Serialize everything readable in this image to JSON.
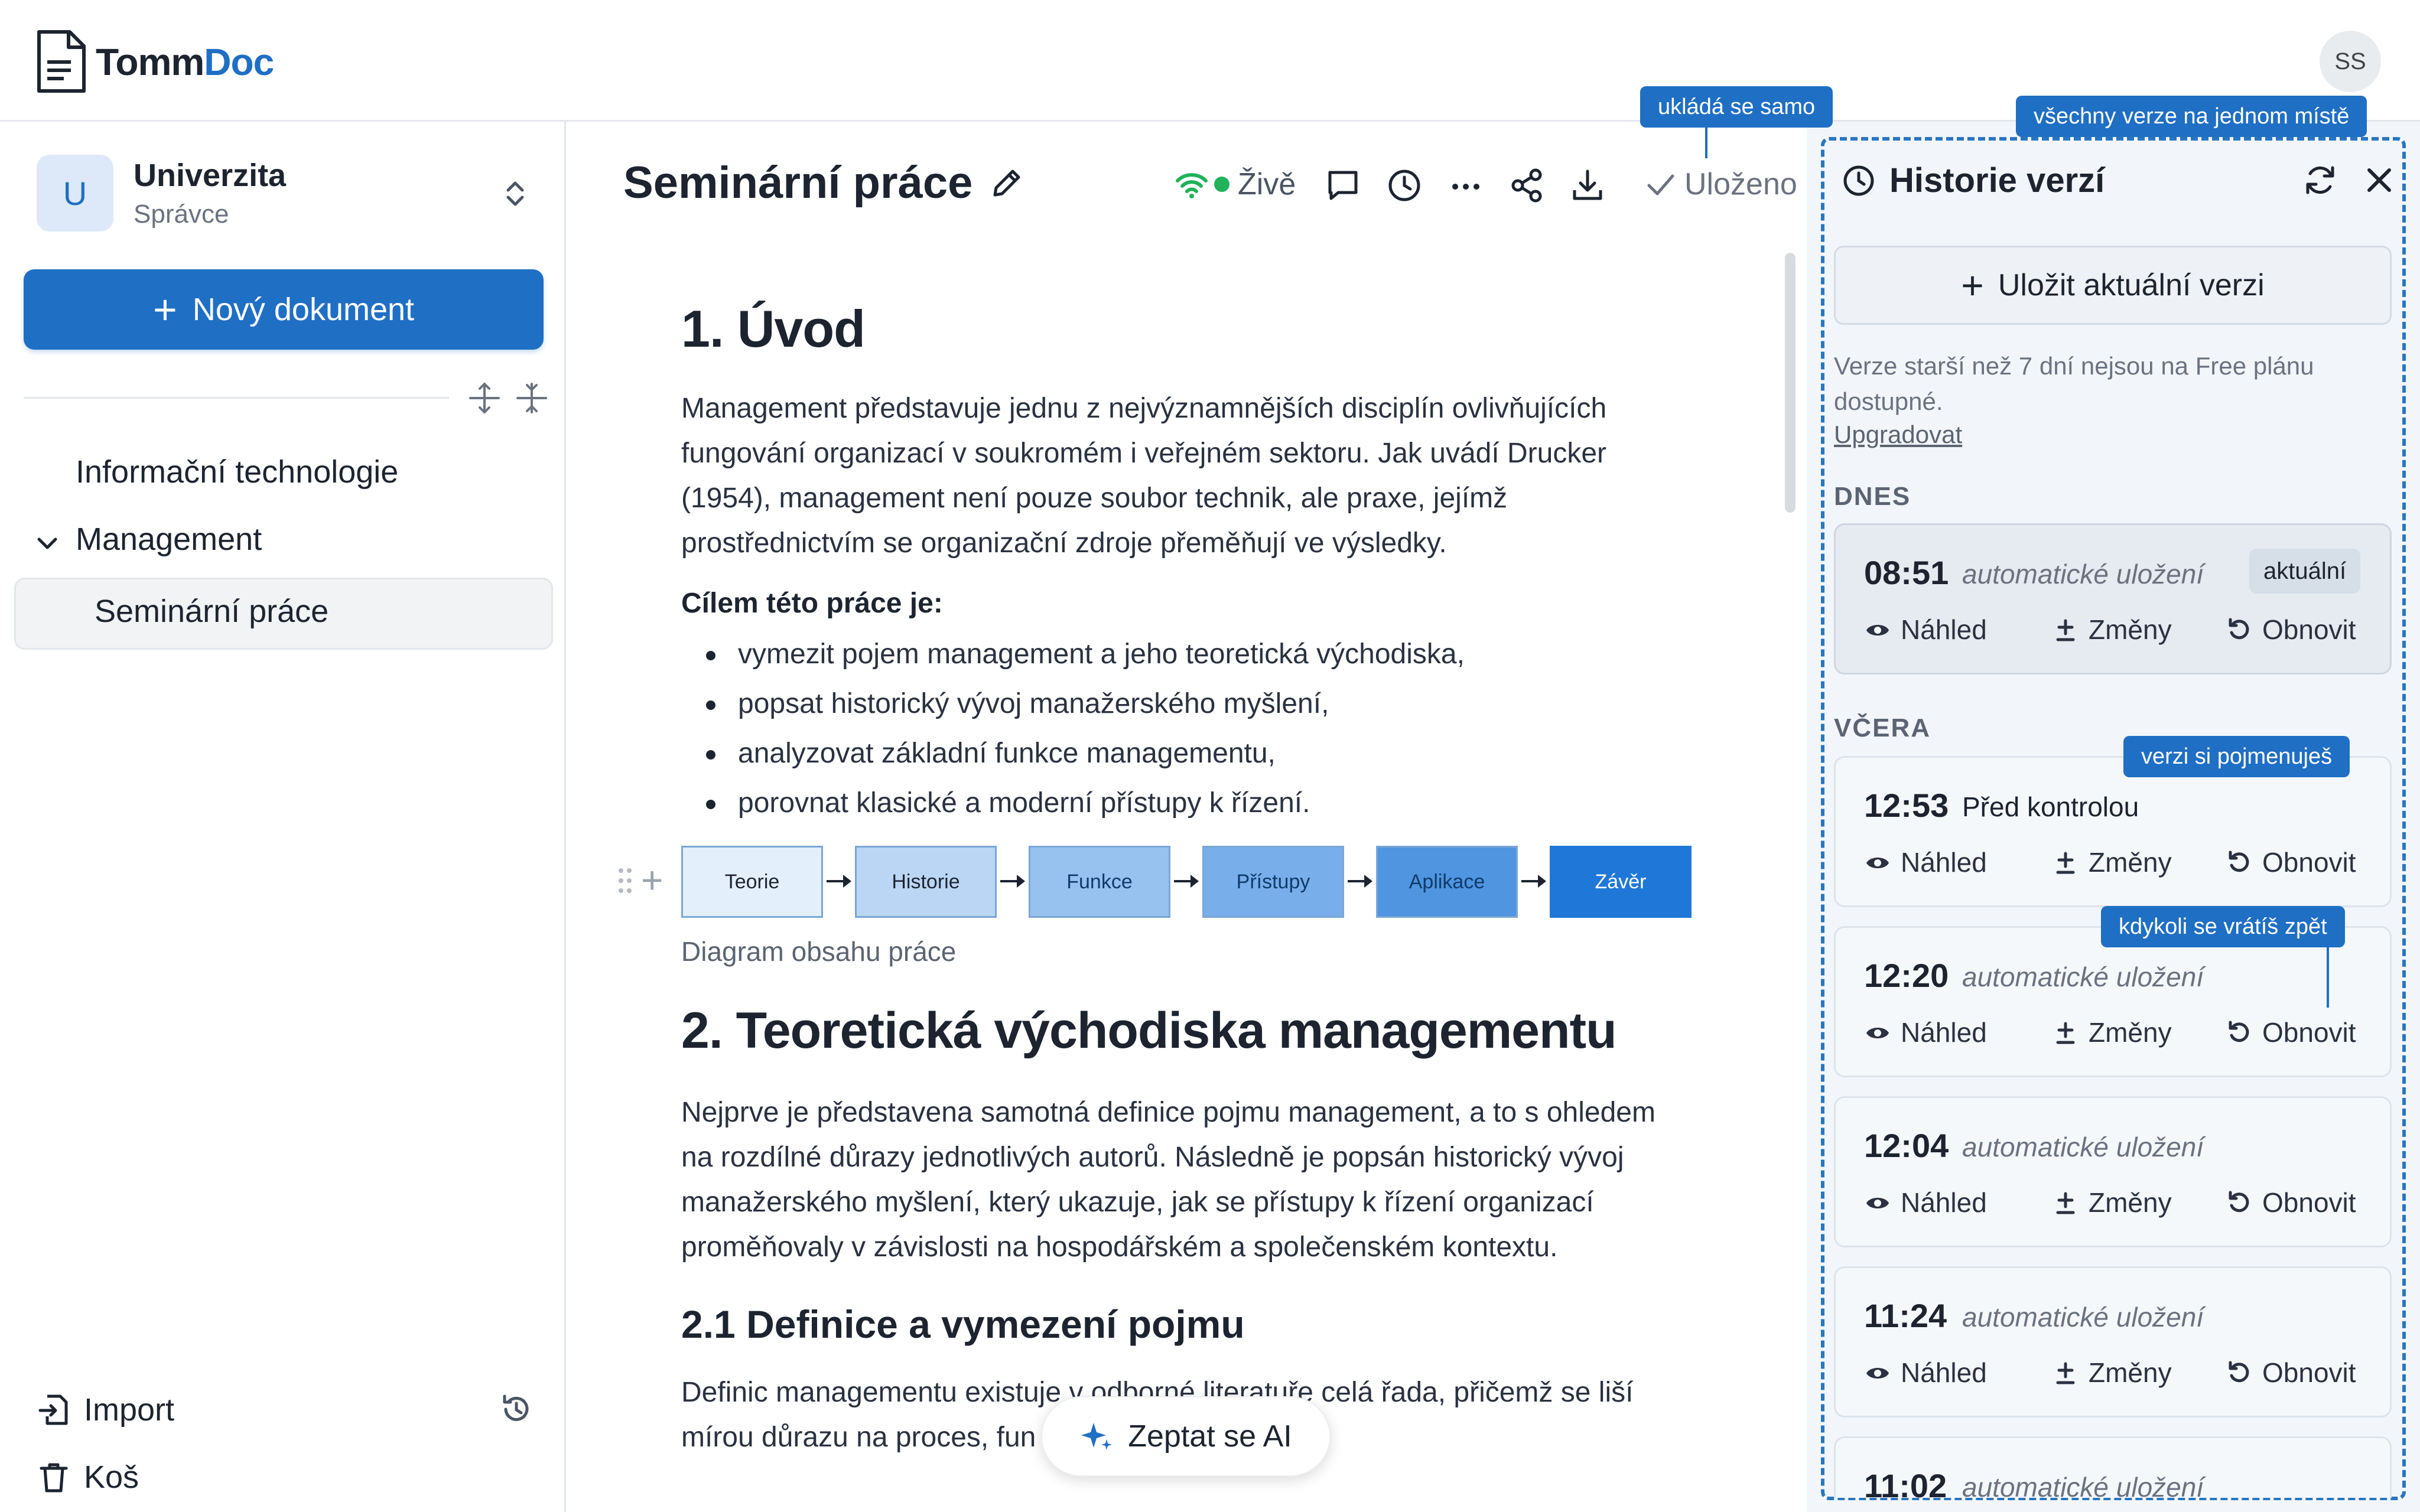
{
  "app": {
    "logo_part1": "Tomm",
    "logo_part2": "Doc",
    "user_initials": "SS"
  },
  "sidebar": {
    "workspace_initial": "U",
    "workspace_name": "Univerzita",
    "workspace_role": "Správce",
    "new_doc_label": "Nový dokument",
    "tree": [
      {
        "label": "Informační technologie"
      },
      {
        "label": "Management"
      },
      {
        "label": "Seminární práce"
      }
    ],
    "import_label": "Import",
    "trash_label": "Koš"
  },
  "editor": {
    "title": "Seminární práce",
    "live_label": "Živě",
    "saved_label": "Uloženo",
    "h1_intro": "1. Úvod",
    "p1_lines": [
      "Management představuje jednu z nejvýznamnějších disciplín ovlivňujících",
      "fungování organizací v soukromém i veřejném sektoru. Jak uvádí Drucker",
      "(1954), management není pouze soubor technik, ale praxe, jejímž",
      "prostřednictvím se organizační zdroje přeměňují ve výsledky."
    ],
    "goals_label": "Cílem této práce je:",
    "bullets": [
      "vymezit pojem management a jeho teoretická východiska,",
      "popsat historický vývoj manažerského myšlení,",
      "analyzovat základní funkce managementu,",
      "porovnat klasické a moderní přístupy k řízení."
    ],
    "diagram_nodes": [
      "Teorie",
      "Historie",
      "Funkce",
      "Přístupy",
      "Aplikace",
      "Závěr"
    ],
    "diagram_colors": [
      "#e3effb",
      "#bad6f4",
      "#97c2ef",
      "#78afea",
      "#4f95e0",
      "#1f78d8"
    ],
    "diagram_caption": "Diagram obsahu práce",
    "h1_theory": "2. Teoretická východiska managementu",
    "p2_lines": [
      "Nejprve je představena samotná definice pojmu management, a to s ohledem",
      "na rozdílné důrazy jednotlivých autorů. Následně je popsán historický vývoj",
      "manažerského myšlení, který ukazuje, jak se přístupy k řízení organizací",
      "proměňovaly v závislosti na hospodářském a společenském kontextu."
    ],
    "h2_definition": "2.1 Definice a vymezení pojmu",
    "p3_lines": [
      "Definic managementu existuje v odborné literatuře celá řada, přičemž se liší",
      "mírou důrazu na proces, fun"
    ],
    "ai_button_label": "Zeptat se AI"
  },
  "history": {
    "title": "Historie verzí",
    "save_current_label": "Uložit aktuální verzi",
    "note": "Verze starší než 7 dní nejsou na Free plánu dostupné.",
    "upgrade_label": "Upgradovat",
    "section_today": "DNES",
    "section_yesterday": "VČERA",
    "action_preview": "Náhled",
    "action_changes": "Změny",
    "action_restore": "Obnovit",
    "versions": [
      {
        "time": "08:51",
        "label": "automatické uložení",
        "badge": "aktuální"
      },
      {
        "time": "12:53",
        "label": "Před kontrolou"
      },
      {
        "time": "12:20",
        "label": "automatické uložení"
      },
      {
        "time": "12:04",
        "label": "automatické uložení"
      },
      {
        "time": "11:24",
        "label": "automatické uložení"
      },
      {
        "time": "11:02",
        "label": "automatické uložení"
      }
    ]
  },
  "callouts": {
    "autosave": "ukládá se samo",
    "all_versions": "všechny verze na jednom místě",
    "name_versions": "verzi si pojmenuješ",
    "go_back": "kdykoli se vrátíš zpět"
  },
  "colors": {
    "accent": "#1f6fc4",
    "live_dot": "#1fb25a",
    "panel_bg": "#f2f6fb"
  }
}
